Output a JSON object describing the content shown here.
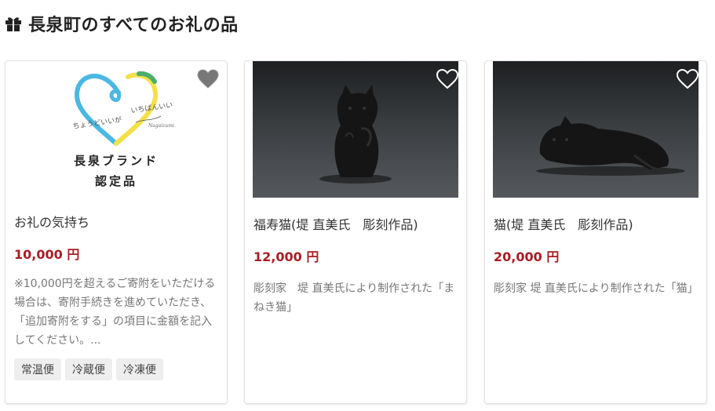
{
  "section": {
    "icon": "gift-icon",
    "title": "長泉町のすべてのお礼の品"
  },
  "products": [
    {
      "image": {
        "kind": "brand-logo",
        "brand_line1": "長泉ブランド",
        "brand_line2": "認定品",
        "logo_script_left": "ちょうどいいが",
        "logo_script_right": "いちばんいい",
        "logo_signature": "Nagaizumi"
      },
      "favorite_icon": "heart-icon",
      "favorite_active": true,
      "title": "お礼の気持ち",
      "price": "10,000 円",
      "description": "※10,000円を超えるご寄附をいただける場合は、寄附手続きを進めていただき、「追加寄附をする」の項目に金額を記入してください。...",
      "tags": [
        "常温便",
        "冷蔵便",
        "冷凍便"
      ]
    },
    {
      "image": {
        "kind": "photo",
        "subject": "sitting-cat-sculpture"
      },
      "favorite_icon": "heart-outline-icon",
      "favorite_active": false,
      "title": "福寿猫(堤 直美氏　彫刻作品)",
      "price": "12,000 円",
      "description": "彫刻家　堤 直美氏により制作された「まねき猫」",
      "tags": []
    },
    {
      "image": {
        "kind": "photo",
        "subject": "lying-cat-sculpture"
      },
      "favorite_icon": "heart-outline-icon",
      "favorite_active": false,
      "title": "猫(堤 直美氏　彫刻作品)",
      "price": "20,000 円",
      "description": "彫刻家 堤 直美氏により制作された「猫」",
      "tags": []
    }
  ],
  "colors": {
    "price": "#a81d24",
    "logo_blue": "#4ab8e2",
    "logo_yellow": "#f3e14a",
    "logo_green": "#4cae6e"
  }
}
